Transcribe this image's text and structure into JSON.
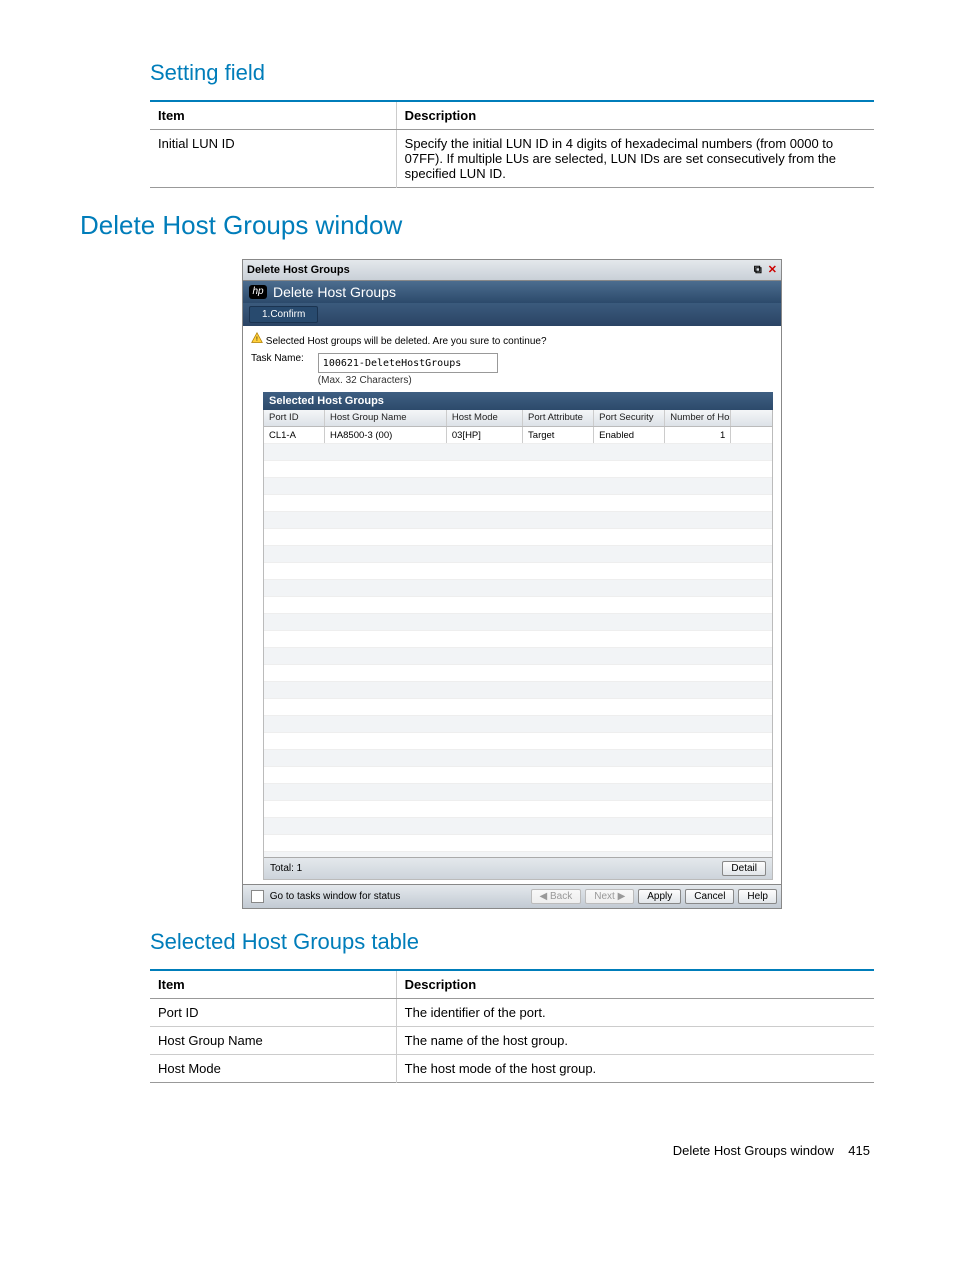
{
  "section1": {
    "heading": "Setting field"
  },
  "table1": {
    "headers": [
      "Item",
      "Description"
    ],
    "rows": [
      {
        "item": "Initial LUN ID",
        "desc": "Specify the initial LUN ID in 4 digits of hexadecimal numbers (from 0000 to 07FF). If multiple LUs are selected, LUN IDs are set consecutively from the specified LUN ID."
      }
    ]
  },
  "section2": {
    "heading": "Delete Host Groups window"
  },
  "win": {
    "titlebar": "Delete Host Groups",
    "header": "Delete Host Groups",
    "step": "1.Confirm",
    "warning": "Selected Host groups will be deleted. Are you sure to continue?",
    "task_label": "Task Name:",
    "task_value": "100621-DeleteHostGroups",
    "task_hint": "(Max. 32 Characters)",
    "panel_title": "Selected Host Groups",
    "grid_headers": {
      "port_id": "Port ID",
      "hg_name": "Host Group Name",
      "host_mode": "Host Mode",
      "port_attr": "Port Attribute",
      "port_sec": "Port Security",
      "num_hosts": "Number of Hosts"
    },
    "grid_rows": [
      {
        "port_id": "CL1-A",
        "hg_name": "HA8500-3 (00)",
        "host_mode": "03[HP]",
        "port_attr": "Target",
        "port_sec": "Enabled",
        "num_hosts": "1"
      }
    ],
    "total_label": "Total: 1",
    "detail_btn": "Detail",
    "footer": {
      "go_tasks": "Go to tasks window for status",
      "back": "◀ Back",
      "next": "Next ▶",
      "apply": "Apply",
      "cancel": "Cancel",
      "help": "Help"
    }
  },
  "section3": {
    "heading": "Selected Host Groups table"
  },
  "table3": {
    "headers": [
      "Item",
      "Description"
    ],
    "rows": [
      {
        "item": "Port ID",
        "desc": "The identifier of the port."
      },
      {
        "item": "Host Group Name",
        "desc": "The name of the host group."
      },
      {
        "item": "Host Mode",
        "desc": "The host mode of the host group."
      }
    ]
  },
  "page_footer": {
    "title": "Delete Host Groups window",
    "page": "415"
  }
}
